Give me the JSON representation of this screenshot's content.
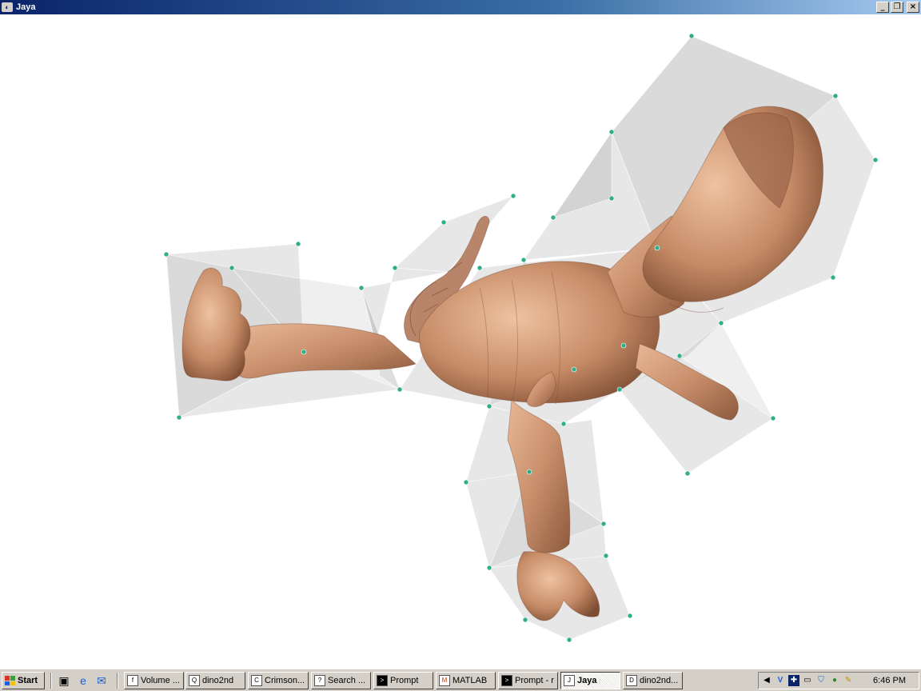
{
  "window": {
    "title": "Jaya"
  },
  "title_controls": {
    "minimize": "_",
    "restore": "❐",
    "close": "×"
  },
  "viewport": {
    "content": "3D dinosaur mesh with control cage",
    "colors": {
      "skin": "#c98f6c",
      "cage": "#808080",
      "vertex": "#2fae8a"
    }
  },
  "taskbar": {
    "start_label": "Start",
    "quick_launch": [
      {
        "icon": "show-desktop-icon"
      },
      {
        "icon": "internet-explorer-icon"
      },
      {
        "icon": "outlook-express-icon"
      }
    ],
    "tasks": [
      {
        "label": "Volume ...",
        "icon": "document-icon",
        "glyph": "f"
      },
      {
        "label": "dino2nd",
        "icon": "image-viewer-icon",
        "glyph": "Q"
      },
      {
        "label": "Crimson...",
        "icon": "editor-icon",
        "glyph": "C"
      },
      {
        "label": "Search ...",
        "icon": "search-icon",
        "glyph": "?"
      },
      {
        "label": "Prompt",
        "icon": "console-icon",
        "glyph": ">"
      },
      {
        "label": "MATLAB",
        "icon": "matlab-icon",
        "glyph": "M"
      },
      {
        "label": "Prompt - r",
        "icon": "console-icon",
        "glyph": ">"
      },
      {
        "label": "Jaya",
        "icon": "jaya-icon",
        "glyph": "J"
      },
      {
        "label": "dino2nd...",
        "icon": "image-icon",
        "glyph": "D"
      }
    ],
    "tray_icons": [
      "speaker-icon",
      "vc-icon",
      "network-icon",
      "monitor-icon",
      "shield-icon",
      "globe-icon",
      "pen-icon"
    ],
    "clock": "6:46 PM"
  }
}
